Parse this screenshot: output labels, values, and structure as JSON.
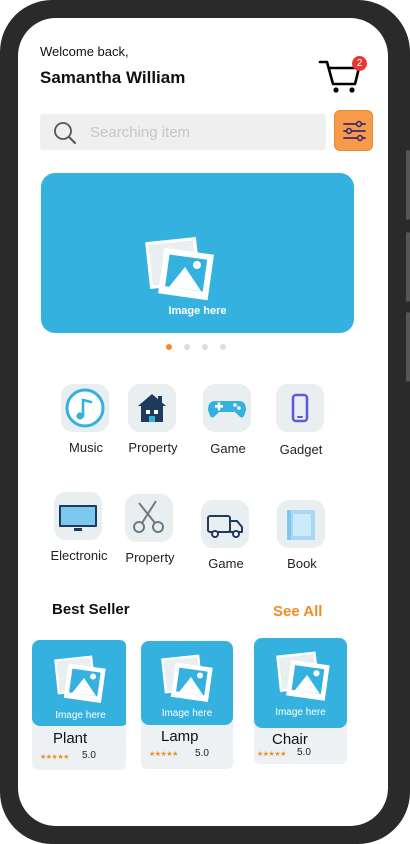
{
  "header": {
    "greeting": "Welcome back,",
    "user_name": "Samantha William",
    "cart_icon": "cart-icon",
    "cart_count": "2"
  },
  "search": {
    "placeholder": "Searching item",
    "icon": "search-icon",
    "filter_icon": "sliders-icon"
  },
  "banner": {
    "caption": "Image here",
    "icon": "image-placeholder-icon",
    "slide_count": 4,
    "active_slide": 1
  },
  "categories": [
    {
      "label": "Music",
      "icon": "music-icon"
    },
    {
      "label": "Property",
      "icon": "house-icon"
    },
    {
      "label": "Game",
      "icon": "gamepad-icon"
    },
    {
      "label": "Gadget",
      "icon": "phone-icon"
    },
    {
      "label": "Electronic",
      "icon": "monitor-icon"
    },
    {
      "label": "Property",
      "icon": "scissors-icon"
    },
    {
      "label": "Game",
      "icon": "truck-icon"
    },
    {
      "label": "Book",
      "icon": "book-icon"
    }
  ],
  "best_seller": {
    "title": "Best Seller",
    "see_all": "See All",
    "products": [
      {
        "name": "Plant",
        "caption": "Image here",
        "stars": "★★★★★",
        "rating": "5.0"
      },
      {
        "name": "Lamp",
        "caption": "Image here",
        "stars": "★★★★★",
        "rating": "5.0"
      },
      {
        "name": "Chair",
        "caption": "Image here",
        "stars": "★★★★★",
        "rating": "5.0"
      }
    ]
  },
  "colors": {
    "accent_blue": "#35b1df",
    "accent_orange": "#f28c28",
    "badge_red": "#e53935",
    "filter_bg": "#f79a4a"
  }
}
